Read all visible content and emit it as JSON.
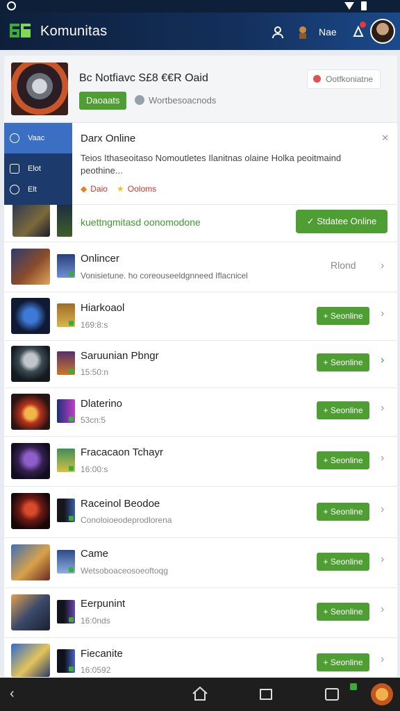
{
  "app": {
    "title": "Komunitas"
  },
  "header": {
    "label": "Nae"
  },
  "featured": {
    "title": "Bc Notfiavc S£8 €€R Oaid",
    "tag": "Daoaats",
    "subtitle": "Wortbesoacnods",
    "action": "Ootfkoniatne"
  },
  "side_menu": {
    "items": [
      {
        "label": "Vaac"
      },
      {
        "label": "Elot"
      },
      {
        "label": "Elt"
      }
    ]
  },
  "popup": {
    "title": "Darx Online",
    "close": "✕",
    "text": "Teios Ithaseoitaso Nomoutletes Ilanitnas olaine Holka peoitmaind peothine...",
    "tag1": "Daio",
    "tag2": "Ooloms"
  },
  "online_row": {
    "text": "kuettngmitasd oonomodone",
    "button": "✓ Stdatee Online"
  },
  "rows": [
    {
      "name": "Onlincer",
      "sub": "Vonisietune. ho coreouseeldgnneed Iflacnicel",
      "status": "Rlond",
      "button": ""
    },
    {
      "name": "Hiarkoaol",
      "sub": "169:8:s",
      "status": "",
      "button": "Seonline"
    },
    {
      "name": "Saruunian Pbngr",
      "sub": "15:50:n",
      "status": "",
      "button": "Seonline"
    },
    {
      "name": "Dlaterino",
      "sub": "53cn:5",
      "status": "",
      "button": "Seonline"
    },
    {
      "name": "Fracacaon Tchayr",
      "sub": "16:00:s",
      "status": "",
      "button": "Seonline"
    },
    {
      "name": "Raceinol Beodoe",
      "sub": "Conoloioeodeprodlorena",
      "status": "",
      "button": "Seonline"
    },
    {
      "name": "Came",
      "sub": "Wetsoboaceosoeoftoqg",
      "status": "",
      "button": "Seonline"
    },
    {
      "name": "Eerpunint",
      "sub": "16:0nds",
      "status": "",
      "button": "Seonline"
    },
    {
      "name": "Fiecanite",
      "sub": "16:0592",
      "status": "",
      "button": "Seonline"
    }
  ],
  "colors": {
    "header_bg": "#0e1f3a",
    "accent_green": "#4f9e34",
    "side_menu_bg": "#1d3a6d",
    "side_menu_active": "#3b6fc4"
  },
  "icons": {
    "status_left": "circle-icon",
    "wifi": "wifi-icon",
    "battery": "battery-icon",
    "user": "user-icon",
    "character": "character-icon",
    "notification": "notification-icon",
    "back": "back-icon",
    "home": "home-icon",
    "recents": "recents-icon"
  }
}
